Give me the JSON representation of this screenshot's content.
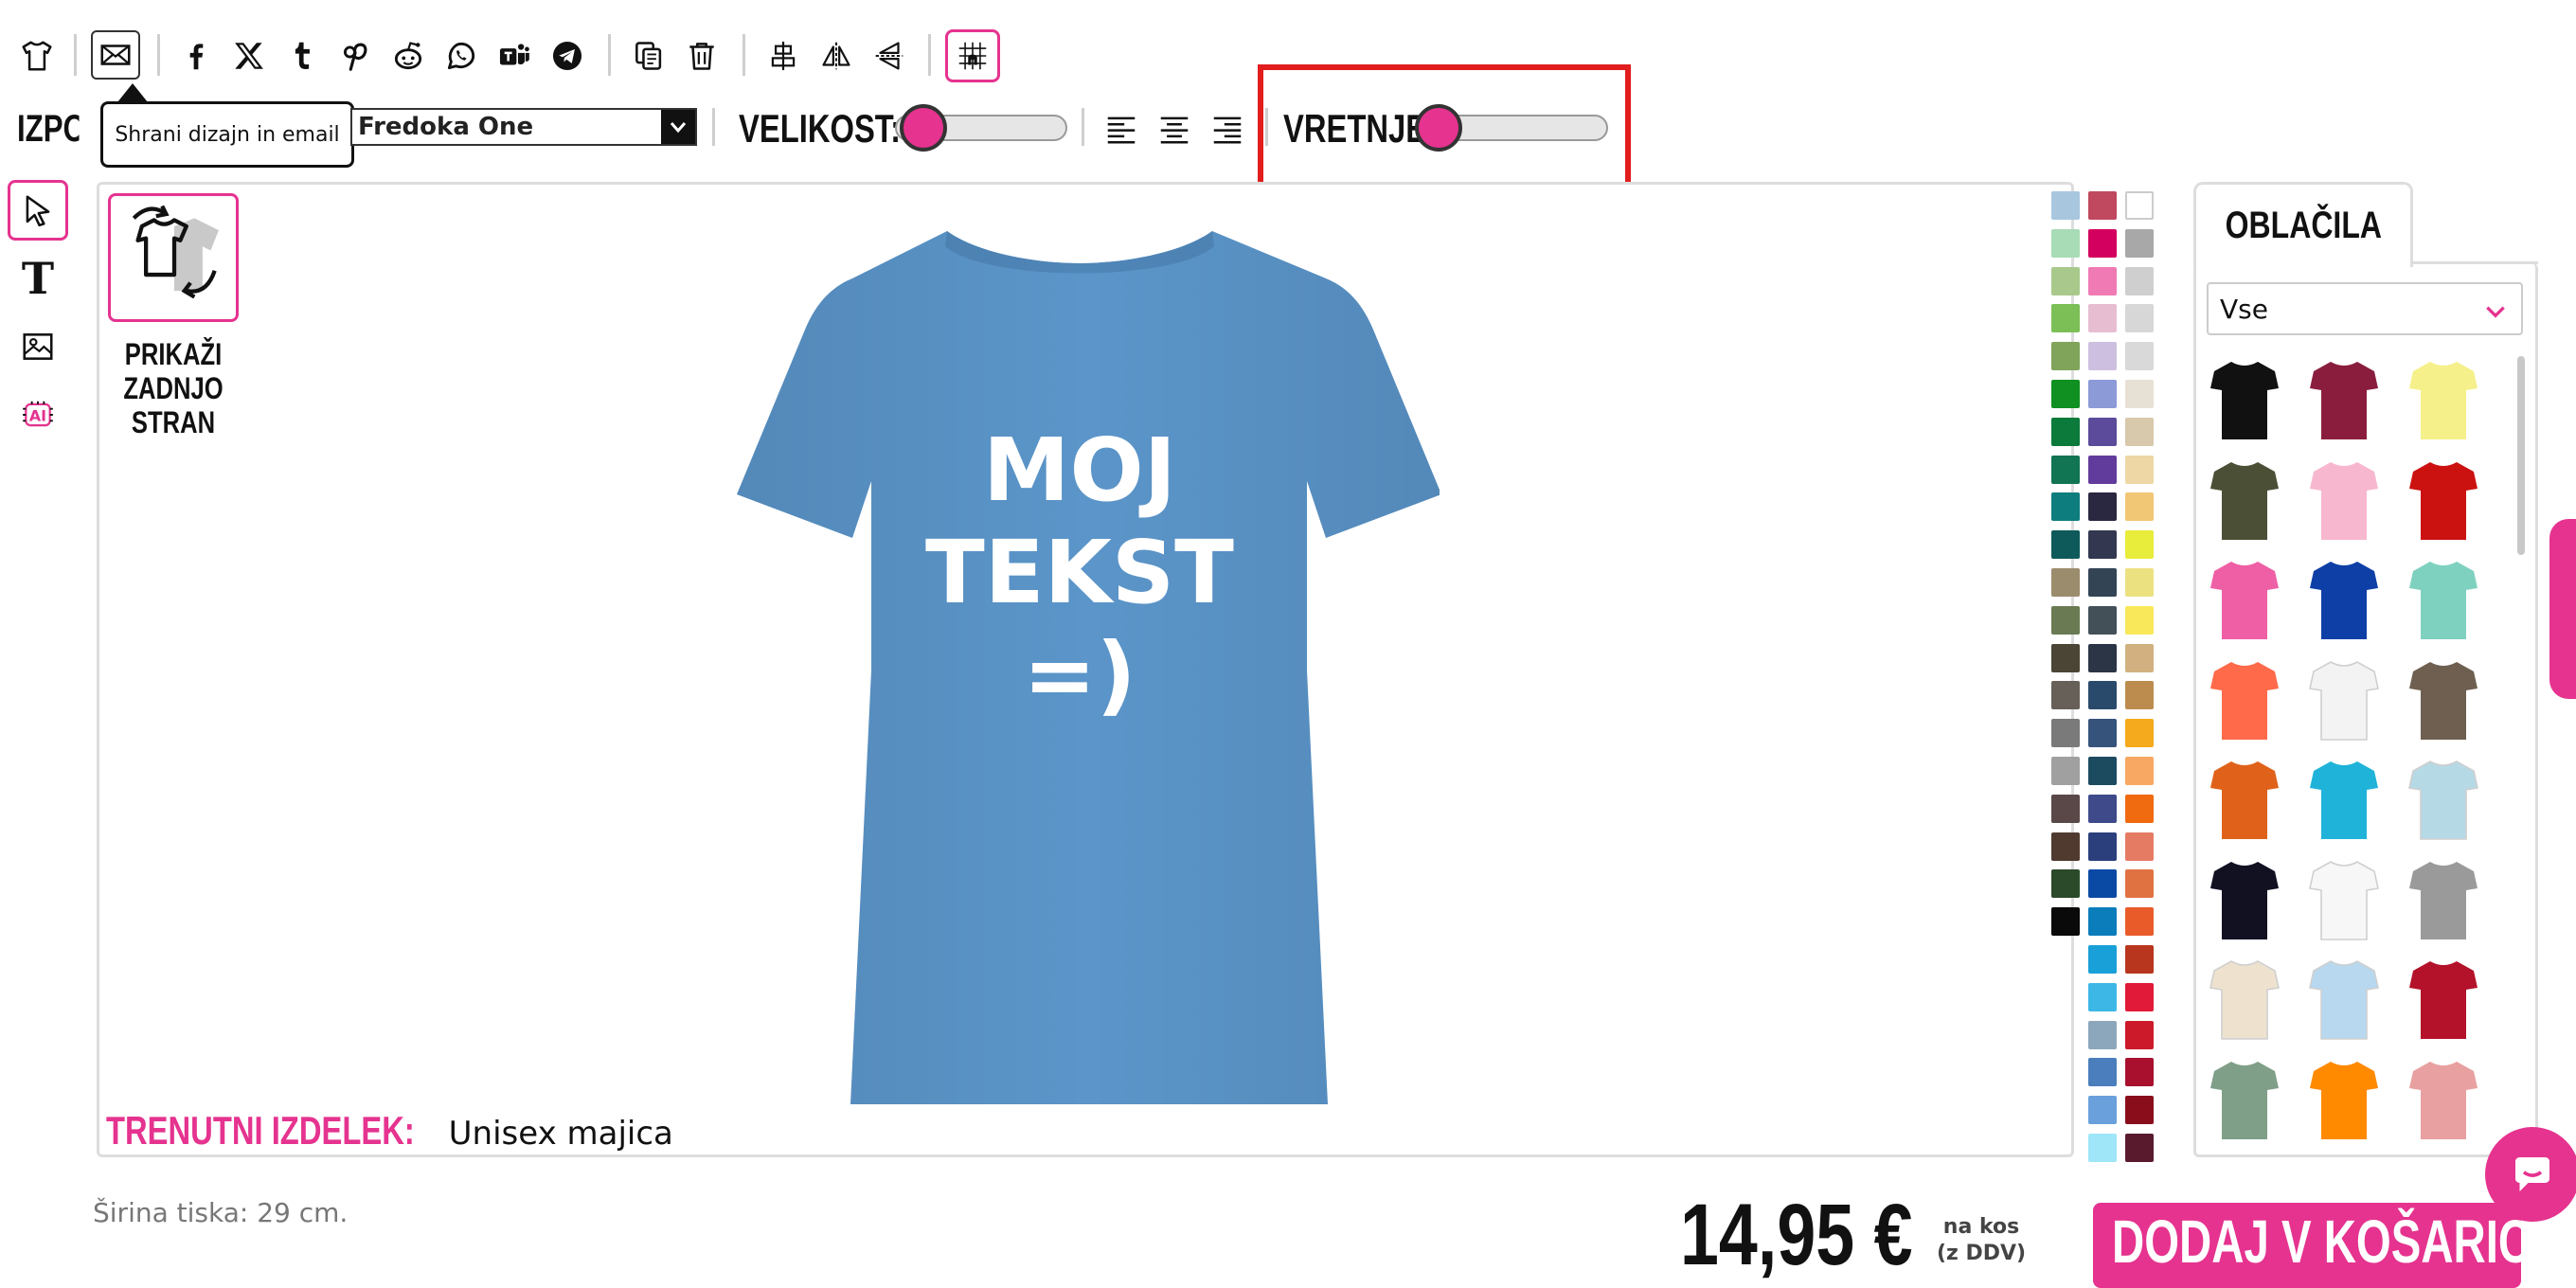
{
  "toolbar": {
    "tooltip": "Shrani dizajn in email",
    "icons": [
      "tshirt-icon",
      "email-icon",
      "facebook-icon",
      "x-twitter-icon",
      "tumblr-icon",
      "pinterest-icon",
      "reddit-icon",
      "whatsapp-icon",
      "teams-icon",
      "telegram-icon",
      "copy-icon",
      "trash-icon",
      "align-center-icon",
      "flip-horizontal-icon",
      "flip-vertical-icon",
      "grid-snap-icon"
    ]
  },
  "text_options": {
    "fill_label": "IZPOLN",
    "font_value": "Fredoka One",
    "size_label": "VELIKOST:",
    "size_value": 0.18,
    "rotate_label": "VRETNJE:",
    "rotate_value": 0.1
  },
  "left_tools": [
    "select-icon",
    "text-icon",
    "image-icon",
    "ai-icon"
  ],
  "canvas": {
    "back_side_label": "PRIKAŽI ZADNJO STRAN",
    "design_text": [
      "MOJ",
      "TEKST",
      "=)"
    ],
    "product_prefix": "TRENUTNI IZDELEK:",
    "product_name": "Unisex majica",
    "shirt_color": "#5b95c9"
  },
  "print_width": "Širina tiska: 29 cm.",
  "panel": {
    "tab_label": "OBLAČILA",
    "filter_value": "Vse"
  },
  "footer": {
    "price": "14,95 €",
    "price_note": "na kos (z DDV)",
    "add_to_cart": "DODAJ V KOŠARICO"
  },
  "colors": {
    "accent": "#e5338f",
    "highlight_red": "#e11d1d"
  },
  "swatches_col1": [
    "#a8c6de",
    "#a8dcb6",
    "#a9c98c",
    "#7cbf57",
    "#7fa45a",
    "#109020",
    "#0b7a3a",
    "#117452",
    "#0e7d7e",
    "#0e5a5a",
    "#9b8c6e",
    "#6a7a52",
    "#4a4535",
    "#666058",
    "#7a7a7a",
    "#a0a0a0",
    "#5a4848",
    "#503a30",
    "#2a4a2a",
    "#0a0a0a"
  ],
  "swatches_col2": [
    "#c0485f",
    "#d4005f",
    "#f07ab4",
    "#e7bdd1",
    "#cdbfe0",
    "#8c9ad8",
    "#5b4b9a",
    "#623c9c",
    "#2a2740",
    "#333850",
    "#334455",
    "#445058",
    "#2b3545",
    "#2a4a6c",
    "#36537c",
    "#1c4b60",
    "#3e4a8a",
    "#2a3f7c",
    "#0a4aa4",
    "#0b7dbb",
    "#1aa0d8",
    "#3cb7e6",
    "#8ca7bb",
    "#4a7ebc",
    "#6aa0dc",
    "#9ee6f8"
  ],
  "swatches_col3": [
    "#ffffff",
    "#a8a8a8",
    "#cfcfcf",
    "#d7d7d7",
    "#d9d9d9",
    "#e7e0d4",
    "#d8c8ac",
    "#eed7a4",
    "#f1c674",
    "#e8ec3a",
    "#ece181",
    "#f8e85a",
    "#d2b07f",
    "#bc8c4e",
    "#f4aa1c",
    "#f8a862",
    "#f06a10",
    "#e67b64",
    "#e07242",
    "#e95c2a",
    "#b9361e",
    "#e01a38",
    "#cc1a2a",
    "#a8102e",
    "#8a0d1c",
    "#5a1a2e"
  ],
  "shirts": [
    "#111111",
    "#8a1d3e",
    "#f5f08a",
    "#4a4f36",
    "#f7b7cf",
    "#cc1111",
    "#ef5fa5",
    "#0d3fa6",
    "#7fd1bf",
    "#ff6a4a",
    "#f3f3f3",
    "#6e5f50",
    "#e0621a",
    "#1fb3d9",
    "#b6d9e6",
    "#111122",
    "#f7f7f7",
    "#9a9a9a",
    "#eee2cf",
    "#b7d8ef",
    "#b3122a",
    "#7f9f88",
    "#ff8a00",
    "#e8a0a0"
  ]
}
